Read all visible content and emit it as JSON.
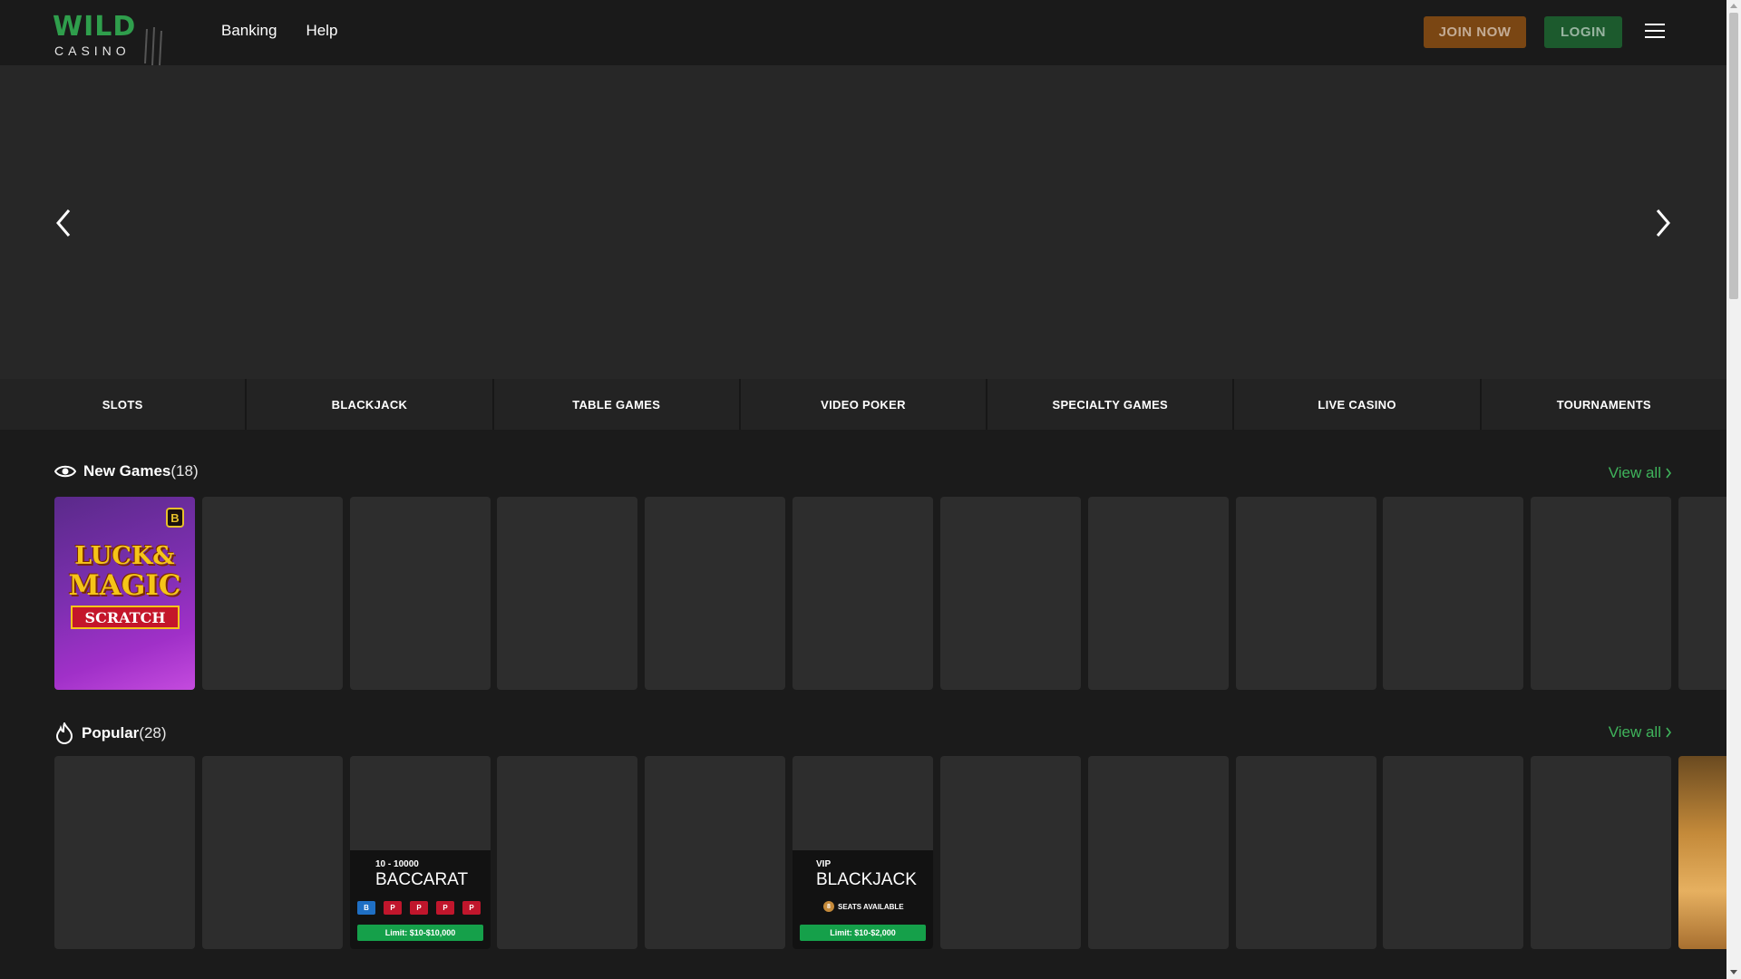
{
  "header": {
    "logo_wild": "WILD",
    "logo_casino": "CASINO",
    "nav": [
      "Banking",
      "Help"
    ],
    "join_label": "JOIN NOW",
    "login_label": "LOGIN"
  },
  "categories": [
    "SLOTS",
    "BLACKJACK",
    "TABLE GAMES",
    "VIDEO POKER",
    "SPECIALTY GAMES",
    "LIVE CASINO",
    "TOURNAMENTS"
  ],
  "sections": {
    "new_games": {
      "title": "New Games",
      "count": "(18)",
      "view_all": "View all"
    },
    "popular": {
      "title": "Popular",
      "count": "(28)",
      "view_all": "View all"
    }
  },
  "games": {
    "luck_magic": {
      "badge": "B",
      "line1": "LUCK&",
      "line2": "MAGIC",
      "line3": "SCRATCH"
    },
    "baccarat": {
      "range": "10 - 10000",
      "name": "BACCARAT",
      "pills": [
        "B",
        "P",
        "P",
        "P",
        "P"
      ],
      "limit": "Limit: $10-$10,000"
    },
    "blackjack": {
      "tier": "VIP",
      "name": "BLACKJACK",
      "seats_icon": "8",
      "seats": "SEATS AVAILABLE",
      "limit": "Limit: $10-$2,000"
    }
  },
  "colors": {
    "accent_green": "#3fb35b",
    "join_bg": "#7a4613",
    "login_bg": "#1c5a2d",
    "background": "#1b1b1b",
    "tile": "#2d2d2d"
  },
  "icons": {
    "hero_prev": "chevron-left-icon",
    "hero_next": "chevron-right-icon",
    "new_games": "eye-icon",
    "popular": "flame-icon",
    "menu": "hamburger-icon"
  }
}
